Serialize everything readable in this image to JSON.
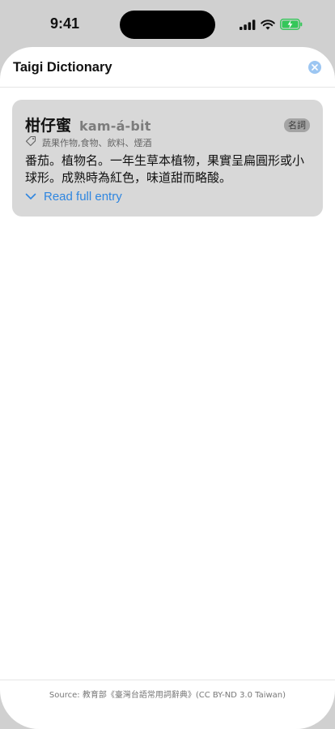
{
  "status_bar": {
    "time": "9:41",
    "icons": [
      "signal-icon",
      "wifi-icon",
      "battery-charging-icon"
    ]
  },
  "sheet": {
    "title": "Taigi Dictionary",
    "close_icon": "close-icon"
  },
  "entry": {
    "word": "柑仔蜜",
    "romanization": "kam-á-bi̍t",
    "part_of_speech": "名詞",
    "tags": "蔬果作物,食物、飲料、煙酒",
    "definition": "番茄。植物名。一年生草本植物，果實呈扁圓形或小球形。成熟時為紅色，味道甜而略酸。",
    "read_more_label": "Read full entry"
  },
  "footer": {
    "source": "Source: 教育部《臺灣台語常用詞辭典》(CC BY-ND 3.0 Taiwan)"
  },
  "colors": {
    "accent": "#2f86e0",
    "card_bg": "#d8d8d8",
    "badge_bg": "#a4a4a4",
    "close_bg": "#9cc6f2",
    "battery_green": "#34c759"
  }
}
